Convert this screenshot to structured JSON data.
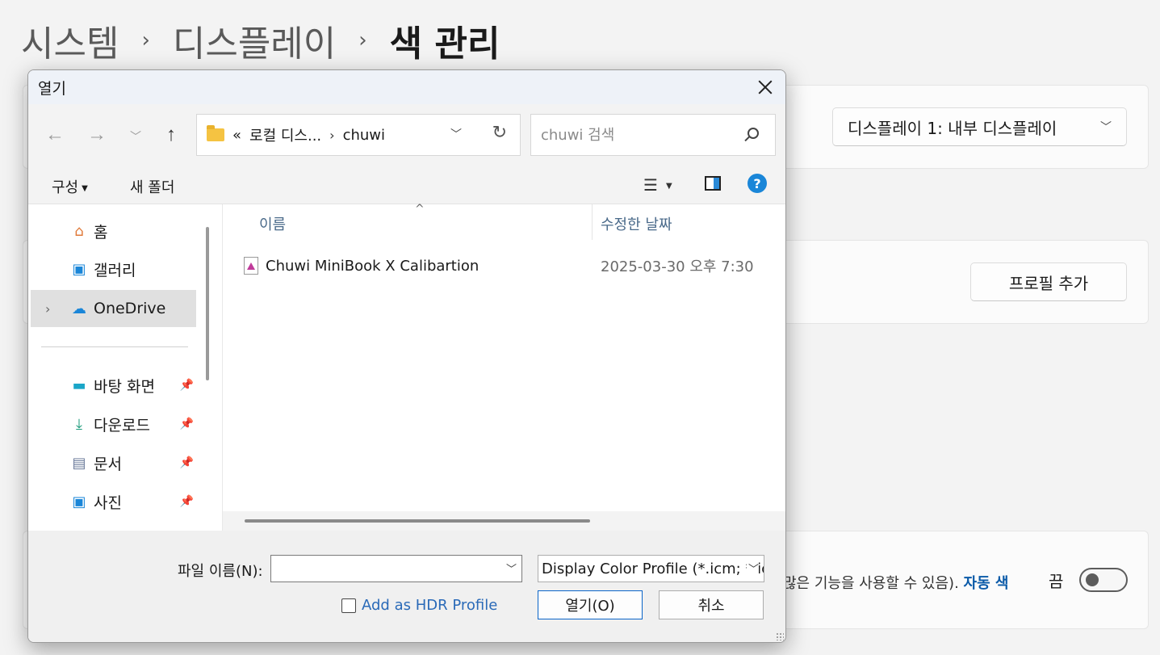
{
  "background": {
    "breadcrumb": {
      "items": [
        "시스템",
        "디스플레이",
        "색 관리"
      ],
      "separator": "›"
    },
    "display_select": {
      "value": "디스플레이 1: 내부 디스플레이"
    },
    "add_profile_button": "프로필 추가",
    "auto_color_fragment": {
      "text": "많은 기능을 사용할 수 있음).",
      "link": "자동 색"
    },
    "toggle": {
      "label": "끔",
      "state": "off"
    }
  },
  "dialog": {
    "title": "열기",
    "address": {
      "prefix": "«",
      "segments": [
        "로컬 디스...",
        "chuwi"
      ],
      "separator": "›"
    },
    "search": {
      "placeholder": "chuwi 검색"
    },
    "toolbar": {
      "organize": "구성",
      "new_folder": "새 폴더",
      "help": "?"
    },
    "nav_items": [
      {
        "label": "홈",
        "icon": "home-icon"
      },
      {
        "label": "갤러리",
        "icon": "gallery-icon"
      },
      {
        "label": "OneDrive",
        "icon": "onedrive-icon",
        "selected": true
      },
      {
        "label": "바탕 화면",
        "icon": "desktop-icon",
        "pinned": true
      },
      {
        "label": "다운로드",
        "icon": "download-icon",
        "pinned": true
      },
      {
        "label": "문서",
        "icon": "documents-icon",
        "pinned": true
      },
      {
        "label": "사진",
        "icon": "pictures-icon",
        "pinned": true
      }
    ],
    "columns": {
      "name": "이름",
      "date": "수정한 날짜"
    },
    "files": [
      {
        "name": "Chuwi MiniBook X Calibartion",
        "date": "2025-03-30 오후 7:30",
        "icon": "color-profile-icon"
      }
    ],
    "file_name": {
      "label": "파일 이름(N):",
      "value": ""
    },
    "file_type": {
      "value": "Display Color Profile (*.icm; *.icc)"
    },
    "hdr_checkbox": {
      "label": "Add as HDR Profile",
      "checked": false
    },
    "open_button": "열기(O)",
    "cancel_button": "취소"
  },
  "colors": {
    "accent": "#0a64c8",
    "link": "#2a6ab8",
    "help": "#1a86d8"
  }
}
